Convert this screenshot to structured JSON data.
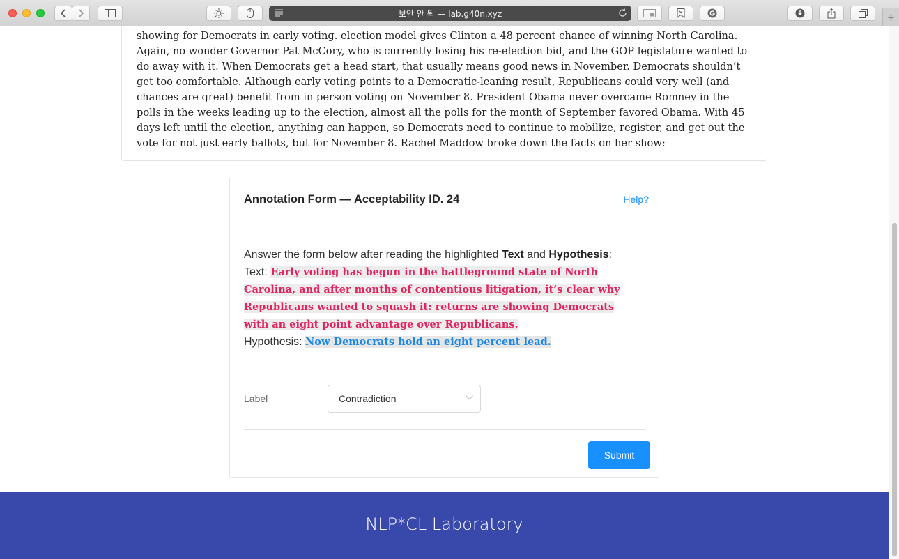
{
  "browser": {
    "address_text": "보안 안 됨 — lab.g40n.xyz",
    "new_tab_symbol": "+"
  },
  "article": {
    "text": "showing for Democrats in early voting. election model gives Clinton a 48 percent chance of winning North Carolina. Again, no wonder Governor Pat McCory, who is currently losing his re-election bid, and the GOP legislature wanted to do away with it. When Democrats get a head start, that usually means good news in November. Democrats shouldn’t get too comfortable. Although early voting points to a Democratic-leaning result, Republicans could very well (and chances are great) benefit from in person voting on November 8. President Obama never overcame Romney in the polls in the weeks leading up to the election, almost all the polls for the month of September favored Obama. With 45 days left until the election, anything can happen, so Democrats need to continue to mobilize, register, and get out the vote for not just early ballots, but for November 8. Rachel Maddow broke down the facts on her show:"
  },
  "form": {
    "title": "Annotation Form — Acceptability ID. 24",
    "help_label": "Help?",
    "instruction_prefix": "Answer the form below after reading the highlighted ",
    "instruction_text_word": "Text",
    "instruction_and": " and ",
    "instruction_hyp_word": "Hypothesis",
    "instruction_suffix": ":",
    "text_label": "Text: ",
    "text_value": "Early voting has begun in the battleground state of North Carolina, and after months of contentious litigation, it’s clear why Republicans wanted to squash it: returns are showing Democrats with an eight point advantage over Republicans.",
    "hypothesis_label": "Hypothesis: ",
    "hypothesis_value": "Now Democrats hold an eight percent lead.",
    "label_caption": "Label",
    "label_selected": "Contradiction",
    "submit_label": "Submit"
  },
  "footer": {
    "brand": "NLP*CL Laboratory"
  },
  "colors": {
    "accent": "#1890ff",
    "text_highlight": "#e0245e",
    "hypothesis_highlight": "#1e88e5",
    "footer_bg": "#3949ab"
  }
}
